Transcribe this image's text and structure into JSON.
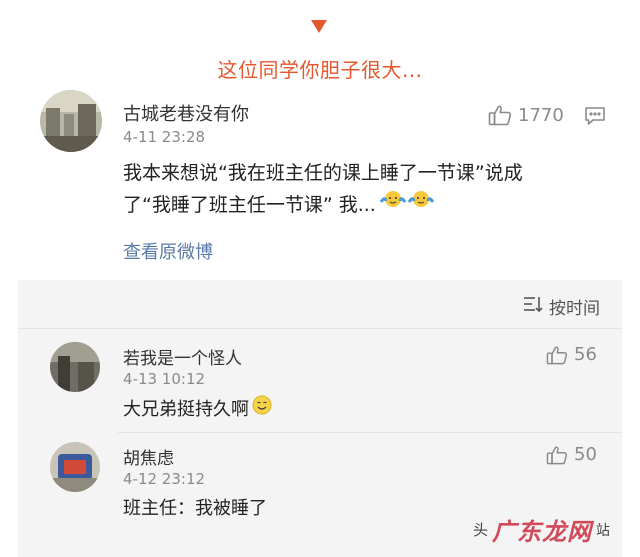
{
  "caption": "这位同学你胆子很大...",
  "main_comment": {
    "username": "古城老巷没有你",
    "time": "4-11 23:28",
    "likes": "1770",
    "content_line1": "我本来想说“我在班主任的课上睡了一节课”说成",
    "content_line2": "了“我睡了班主任一节课” 我...",
    "view_original": "查看原微博"
  },
  "sort": {
    "label": "按时间"
  },
  "replies": [
    {
      "username": "若我是一个怪人",
      "time": "4-13 10:12",
      "likes": "56",
      "content": "大兄弟挺持久啊"
    },
    {
      "username": "胡焦虑",
      "time": "4-12 23:12",
      "likes": "50",
      "content": "班主任：我被睡了"
    }
  ],
  "watermark": {
    "head": "头",
    "logo": "广东龙网",
    "suffix": "站"
  },
  "icons": [
    "down-arrow-icon",
    "thumbs-up-icon",
    "reply-icon",
    "sort-icon",
    "shrug-emoji-icon",
    "smile-emoji-icon"
  ],
  "colors": {
    "accent": "#e4572e",
    "link": "#5a7aa8",
    "muted": "#8a8a8a",
    "reply_bg": "#f4f4f4"
  }
}
